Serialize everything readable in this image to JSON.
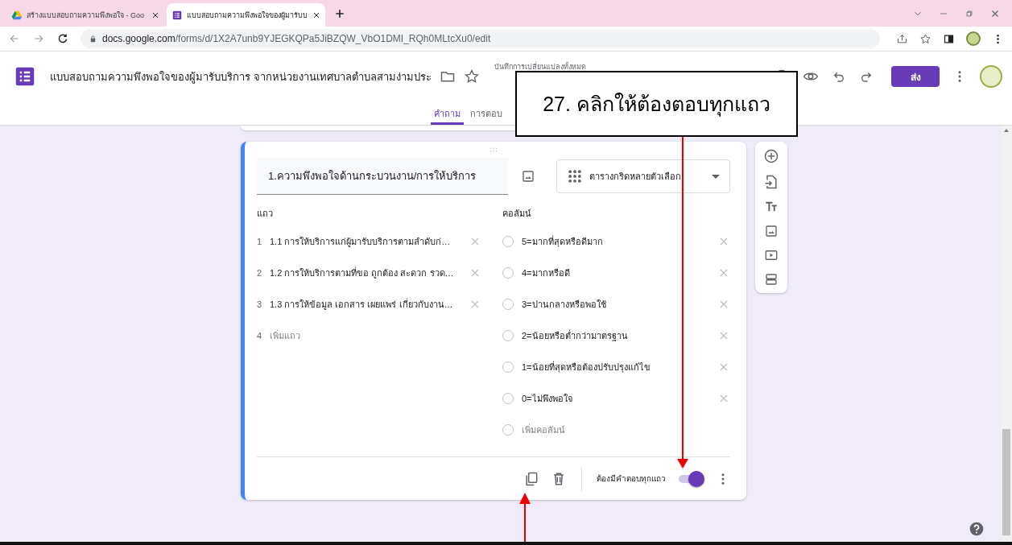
{
  "browser": {
    "tabs": [
      {
        "kind": "drive",
        "title": "สร้างแบบสอบถามความพึงพอใจ - Goo",
        "selected": false
      },
      {
        "kind": "forms",
        "title": "แบบสอบถามความพึงพอใจของผู้มารับบ",
        "selected": true
      }
    ],
    "url": {
      "host": "docs.google.com",
      "path": "/forms/d/1X2A7unb9YJEGKQPa5JiBZQW_VbO1DMI_RQh0MLtcXu0/edit"
    }
  },
  "header": {
    "title": "แบบสอบถามความพึงพอใจของผู้มารับบริการ จากหน่วยงานเทศบาลตำบลสามง่ามประ",
    "save_status": "บันทึกการเปลี่ยนแปลงทั้งหมด",
    "send": "ส่ง",
    "tabs": [
      {
        "label": "คำถาม",
        "selected": true
      },
      {
        "label": "การตอบ",
        "selected": false
      }
    ]
  },
  "question": {
    "title": "1.ความพึงพอใจด้านกระบวนงาน/การให้บริการ",
    "type": "ตารางกริดหลายตัวเลือก",
    "rows_label": "แถว",
    "columns_label": "คอลัมน์",
    "rows": [
      {
        "number": "1",
        "label": "1.1 การให้บริการแก่ผู้มารับบริการตามลำดับก่…"
      },
      {
        "number": "2",
        "label": "1.2 การให้บริการตามที่ขอ ถูกต้อง สะดวก รวด…"
      },
      {
        "number": "3",
        "label": "1.3 การให้ข้อมูล เอกสาร เผยแพร่ เกี่ยวกับงาน…"
      }
    ],
    "add_row": {
      "number": "4",
      "label": "เพิ่มแถว"
    },
    "columns": [
      {
        "label": "5=มากที่สุดหรือดีมาก",
        "checked": false
      },
      {
        "label": "4=มากหรือดี",
        "checked": false
      },
      {
        "label": "3=ปานกลางหรือพอใช้",
        "checked": false
      },
      {
        "label": "2=น้อยหรือต่ำกว่ามาตรฐาน",
        "checked": false
      },
      {
        "label": "1=น้อยที่สุดหรือต้องปรับปรุงแก้ไข",
        "checked": false
      },
      {
        "label": "0=ไม่พึงพอใจ",
        "checked": false
      }
    ],
    "add_column": {
      "label": "เพิ่มคอลัมน์",
      "checked": false
    },
    "required_label": "ต้องมีคำตอบทุกแถว",
    "required": true
  },
  "callout": {
    "text": "27. คลิกให้ต้องตอบทุกแถว"
  }
}
